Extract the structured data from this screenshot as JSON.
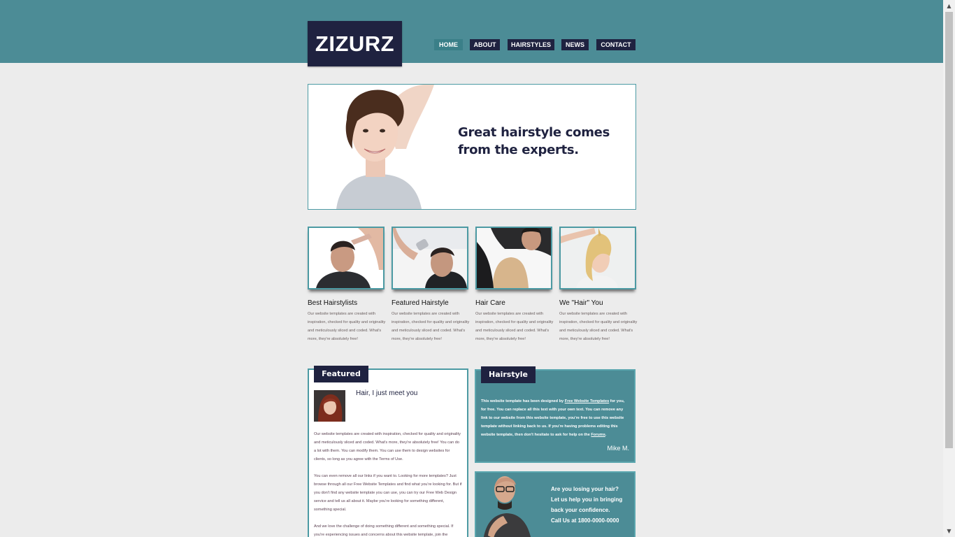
{
  "brand": {
    "name": "ZIZURZ"
  },
  "nav": {
    "items": [
      {
        "label": "HOME",
        "active": true
      },
      {
        "label": "ABOUT",
        "active": false
      },
      {
        "label": "HAIRSTYLES",
        "active": false
      },
      {
        "label": "NEWS",
        "active": false
      },
      {
        "label": "CONTACT",
        "active": false
      }
    ]
  },
  "hero": {
    "headline": "Great hairstyle comes from the experts."
  },
  "features": [
    {
      "title": "Best Hairstylists",
      "text": "Our website templates are created with inspiration, checked for quality and originality and meticulously sliced and coded. What's more, they're absolutely free!"
    },
    {
      "title": "Featured Hairstyle",
      "text": "Our website templates are created with inspiration, checked for quality and originality and meticulously sliced and coded. What's more, they're absolutely free!"
    },
    {
      "title": "Hair Care",
      "text": "Our website templates are created with inspiration, checked for quality and originality and meticulously sliced and coded. What's more, they're absolutely free!"
    },
    {
      "title": "We \"Hair\" You",
      "text": "Our website templates are created with inspiration, checked for quality and originality and meticulously sliced and coded. What's more, they're absolutely free!"
    }
  ],
  "featured": {
    "tab_label": "Featured",
    "heading": "Hair, I just meet you",
    "paragraphs": [
      "Our website templates are created with inspiration, checked for quality and originality and meticulously sliced and coded. What's more, they're absolutely free! You can do a lot with them. You can modify them. You can use them to design websites for clients, so long as you agree with the Terms of Use.",
      "You can even remove all our links if you want to. Looking for more templates? Just browse through all our Free Website Templates and find what you're looking for. But if you don't find any website template you can use, you can try our Free Web Design service and tell us all about it. Maybe you're looking for something different, something special.",
      "And we love the challenge of doing something different and something special. If you're experiencing issues and concerns about this website template, join the"
    ]
  },
  "hairstyle": {
    "tab_label": "Hairstyle",
    "text_1": "This website template has been designed by",
    "link_1": "Free Website Templates",
    "text_2": "for you, for free. You can replace all this text with your own text. You can remove any link to our website from this website template, you're free to use this website template without linking back to us. If you're having problems editing this website template, then don't hesitate to ask for help on the",
    "link_2": "Forums",
    "text_3": ".",
    "signature": "Mike M."
  },
  "promo": {
    "line_1": "Are you losing your hair?",
    "line_2": "Let us help you in bringing back your confidence.",
    "line_3": "Call Us at 1800-0000-0000"
  },
  "colors": {
    "teal": "#4c8c96",
    "navy": "#1f2240",
    "background": "#ececec"
  }
}
